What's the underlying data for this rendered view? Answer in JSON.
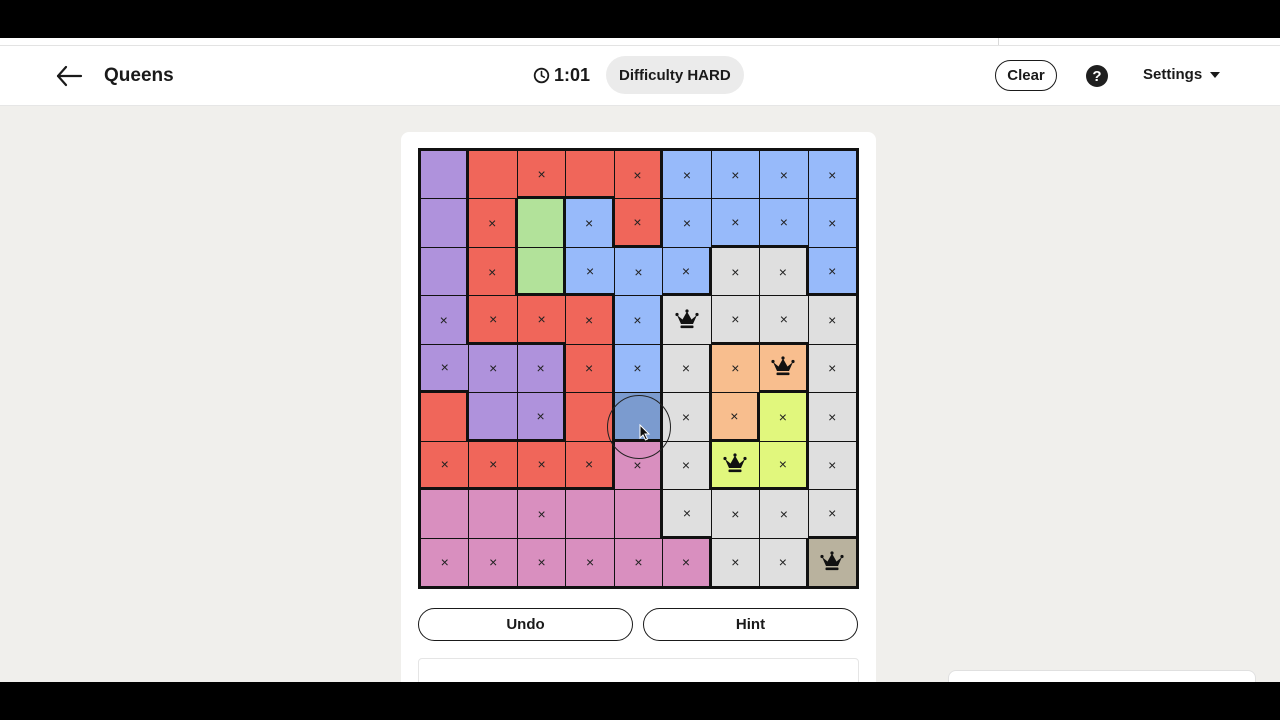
{
  "header": {
    "title": "Queens",
    "timer": "1:01",
    "difficulty": "Difficulty HARD",
    "clear_label": "Clear",
    "help_label": "?",
    "settings_label": "Settings"
  },
  "controls": {
    "undo_label": "Undo",
    "hint_label": "Hint"
  },
  "colors": {
    "purple": "#af92dc",
    "red": "#f0665a",
    "green": "#b2e29a",
    "blue": "#97bafa",
    "gray": "#dfdfdf",
    "orange": "#f8be8e",
    "yellow": "#e1f77d",
    "pink": "#d98fbf",
    "tan": "#b9b29e",
    "hover": "#7b9bcf"
  },
  "board": {
    "size": 9,
    "regions": [
      [
        "purple",
        "red",
        "red",
        "red",
        "red",
        "blue",
        "blue",
        "blue",
        "blue"
      ],
      [
        "purple",
        "red",
        "green",
        "blue",
        "red",
        "blue",
        "blue",
        "blue",
        "blue"
      ],
      [
        "purple",
        "red",
        "green",
        "blue",
        "blue",
        "blue",
        "gray",
        "gray",
        "blue"
      ],
      [
        "purple",
        "red",
        "red",
        "red",
        "blue",
        "gray",
        "gray",
        "gray",
        "gray"
      ],
      [
        "purple",
        "purple",
        "purple",
        "red",
        "blue",
        "gray",
        "orange",
        "orange",
        "gray"
      ],
      [
        "red",
        "purple",
        "purple",
        "red",
        "blue",
        "gray",
        "orange",
        "yellow",
        "gray"
      ],
      [
        "red",
        "red",
        "red",
        "red",
        "pink",
        "gray",
        "yellow",
        "yellow",
        "gray"
      ],
      [
        "pink",
        "pink",
        "pink",
        "pink",
        "pink",
        "gray",
        "gray",
        "gray",
        "gray"
      ],
      [
        "pink",
        "pink",
        "pink",
        "pink",
        "pink",
        "pink",
        "gray",
        "gray",
        "tan"
      ]
    ],
    "marks": [
      [
        "",
        "",
        "x",
        "",
        "x",
        "x",
        "x",
        "x",
        "x"
      ],
      [
        "",
        "x",
        "",
        "x",
        "x",
        "x",
        "x",
        "x",
        "x"
      ],
      [
        "",
        "x",
        "",
        "x",
        "x",
        "x",
        "x",
        "x",
        "x"
      ],
      [
        "x",
        "x",
        "x",
        "x",
        "x",
        "Q",
        "x",
        "x",
        "x"
      ],
      [
        "x",
        "x",
        "x",
        "x",
        "x",
        "x",
        "x",
        "Q",
        "x"
      ],
      [
        "",
        "",
        "x",
        "",
        "",
        "x",
        "x",
        "x",
        "x"
      ],
      [
        "x",
        "x",
        "x",
        "x",
        "x",
        "x",
        "Q",
        "x",
        "x"
      ],
      [
        "",
        "",
        "x",
        "",
        "",
        "x",
        "x",
        "x",
        "x"
      ],
      [
        "x",
        "x",
        "x",
        "x",
        "x",
        "x",
        "x",
        "x",
        "Q"
      ]
    ],
    "hover_cell": [
      5,
      4
    ]
  }
}
